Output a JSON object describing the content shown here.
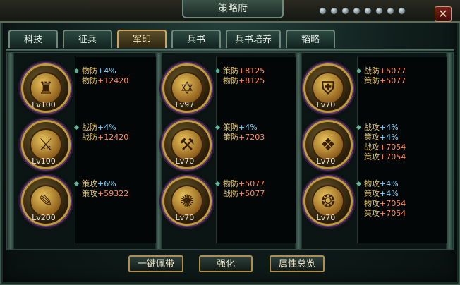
{
  "window": {
    "title": "策略府",
    "close_label": "✕"
  },
  "tabs": [
    {
      "label": "科技",
      "active": false
    },
    {
      "label": "征兵",
      "active": false
    },
    {
      "label": "军印",
      "active": true
    },
    {
      "label": "兵书",
      "active": false
    },
    {
      "label": "兵书培养",
      "active": false
    },
    {
      "label": "韬略",
      "active": false
    }
  ],
  "columns": [
    {
      "seals": [
        {
          "icon": "fortress-icon",
          "glyph": "♜",
          "level": "Lv100",
          "stats": [
            {
              "name": "物防",
              "value": "+4%",
              "kind": "pct"
            },
            {
              "name": "物防",
              "value": "+12420",
              "kind": "num"
            }
          ]
        },
        {
          "icon": "sword-icon",
          "glyph": "⚔",
          "level": "Lv100",
          "stats": [
            {
              "name": "战防",
              "value": "+4%",
              "kind": "pct"
            },
            {
              "name": "战防",
              "value": "+12420",
              "kind": "num"
            }
          ]
        },
        {
          "icon": "scroll-icon",
          "glyph": "✎",
          "level": "Lv200",
          "stats": [
            {
              "name": "策攻",
              "value": "+6%",
              "kind": "pct"
            },
            {
              "name": "策攻",
              "value": "+59322",
              "kind": "num"
            }
          ]
        }
      ]
    },
    {
      "seals": [
        {
          "icon": "star-icon",
          "glyph": "✡",
          "level": "Lv97",
          "stats": [
            {
              "name": "策防",
              "value": "+8125",
              "kind": "num"
            },
            {
              "name": "物防",
              "value": "+8125",
              "kind": "num"
            }
          ]
        },
        {
          "icon": "crossed-blades-icon",
          "glyph": "⚒",
          "level": "Lv70",
          "stats": [
            {
              "name": "策防",
              "value": "+4%",
              "kind": "pct"
            },
            {
              "name": "策防",
              "value": "+7203",
              "kind": "num"
            }
          ]
        },
        {
          "icon": "creature-icon",
          "glyph": "✺",
          "level": "Lv70",
          "stats": [
            {
              "name": "物防",
              "value": "+5077",
              "kind": "num"
            },
            {
              "name": "战防",
              "value": "+5077",
              "kind": "num"
            }
          ]
        }
      ]
    },
    {
      "seals": [
        {
          "icon": "shield-icon",
          "glyph": "⛨",
          "level": "Lv70",
          "stats": [
            {
              "name": "战防",
              "value": "+5077",
              "kind": "num"
            },
            {
              "name": "策防",
              "value": "+5077",
              "kind": "num"
            }
          ]
        },
        {
          "icon": "crystal-icon",
          "glyph": "❖",
          "level": "Lv70",
          "stats": [
            {
              "name": "战攻",
              "value": "+4%",
              "kind": "pct"
            },
            {
              "name": "策攻",
              "value": "+4%",
              "kind": "pct"
            },
            {
              "name": "战攻",
              "value": "+7054",
              "kind": "num"
            },
            {
              "name": "策攻",
              "value": "+7054",
              "kind": "num"
            }
          ]
        },
        {
          "icon": "beast-icon",
          "glyph": "❂",
          "level": "Lv70",
          "stats": [
            {
              "name": "物攻",
              "value": "+4%",
              "kind": "pct"
            },
            {
              "name": "策攻",
              "value": "+4%",
              "kind": "pct"
            },
            {
              "name": "物攻",
              "value": "+7054",
              "kind": "num"
            },
            {
              "name": "策攻",
              "value": "+7054",
              "kind": "num"
            }
          ]
        }
      ]
    }
  ],
  "buttons": {
    "equip_all": "一键佩带",
    "strengthen": "强化",
    "attr_summary": "属性总览"
  }
}
